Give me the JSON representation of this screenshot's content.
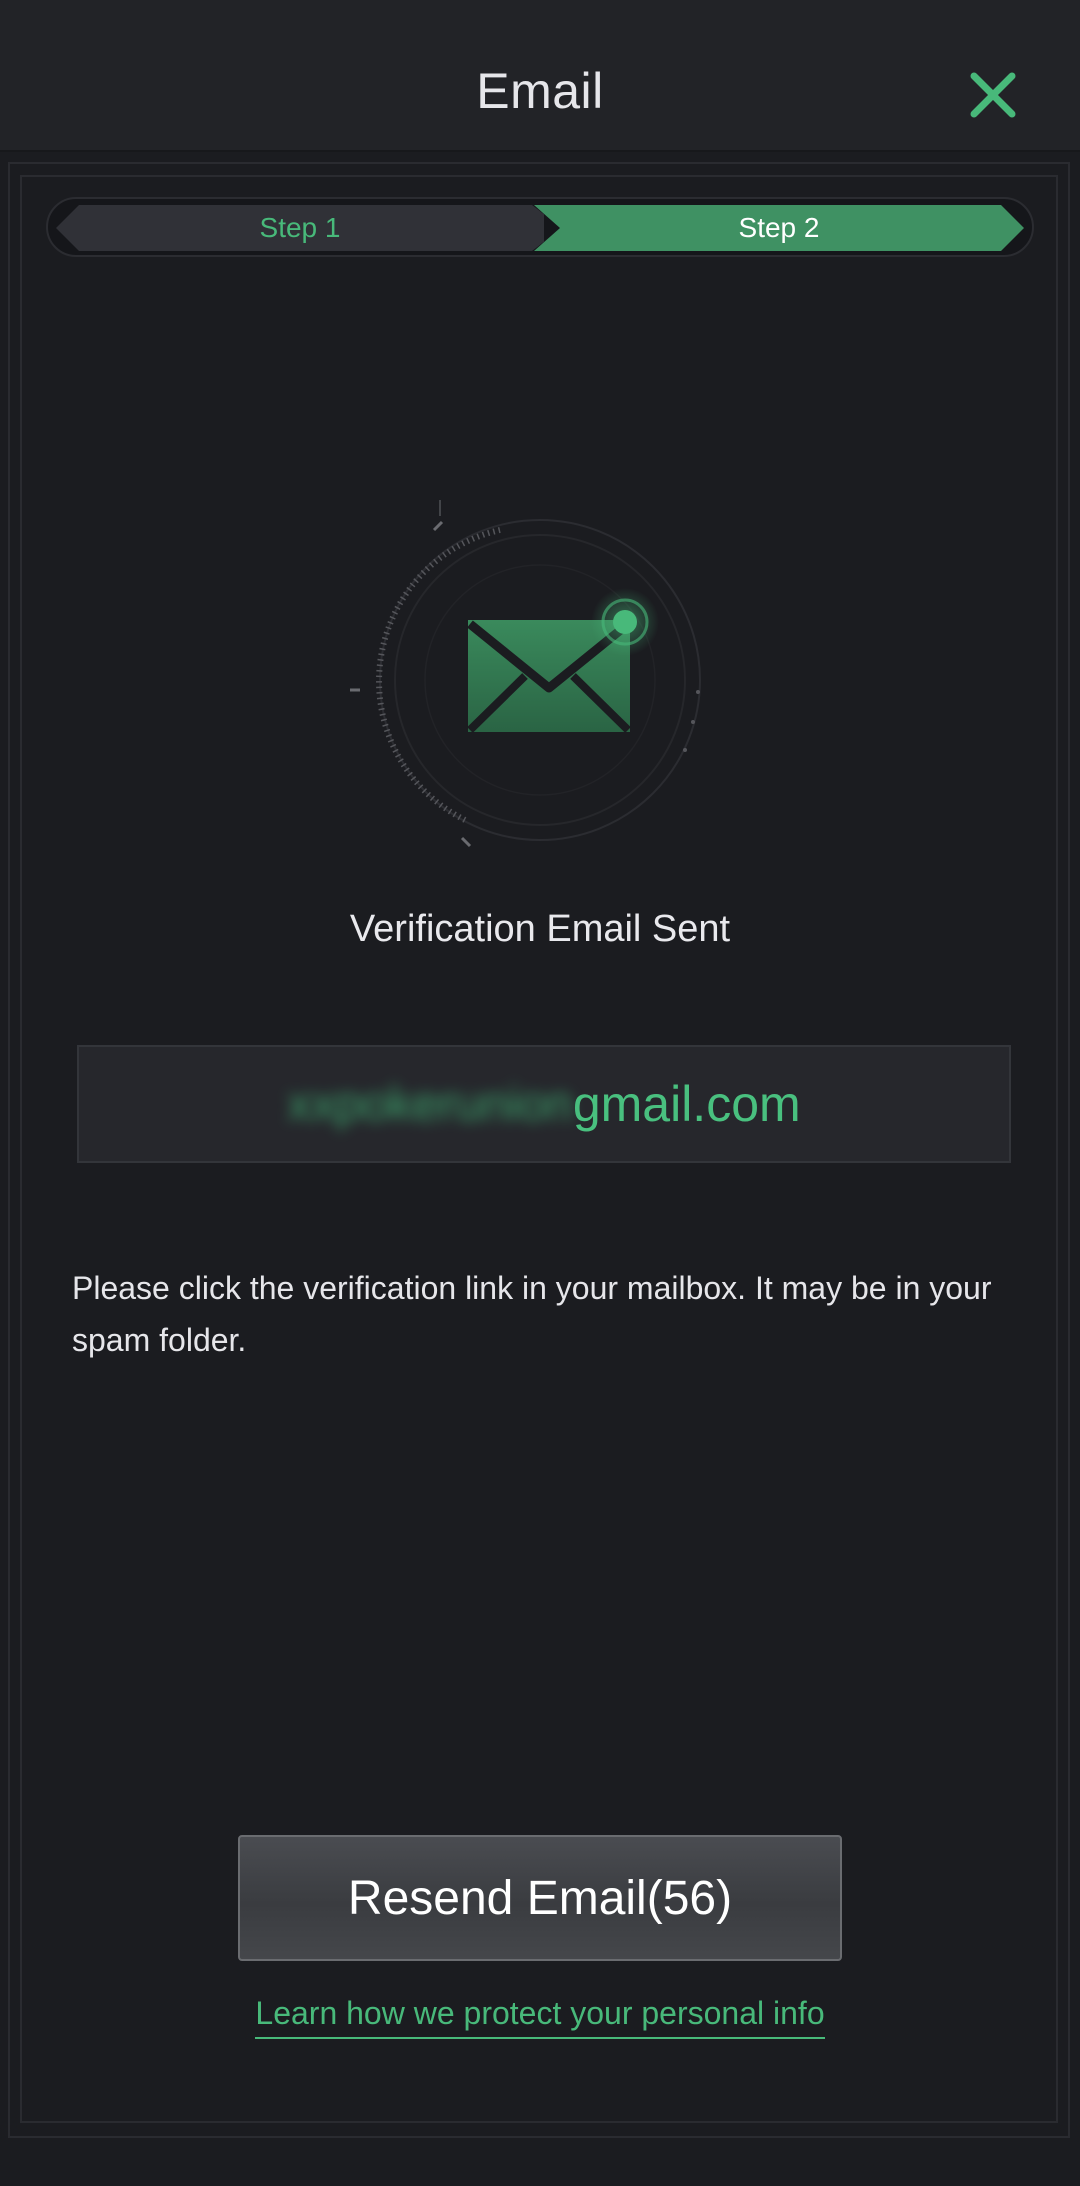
{
  "header": {
    "title": "Email",
    "close_icon": "close-x-icon"
  },
  "steps": {
    "step1_label": "Step 1",
    "step2_label": "Step 2",
    "active_step": 2
  },
  "illustration": {
    "icon": "envelope-icon"
  },
  "main": {
    "status_title": "Verification Email Sent",
    "email_masked_local": "xxpokerunion",
    "email_domain": "gmail.com",
    "instructions": "Please click the verification link in your mailbox. It may be in your spam folder."
  },
  "actions": {
    "resend_label": "Resend Email(56)",
    "learn_link": "Learn how we protect your personal info"
  },
  "colors": {
    "accent_green": "#48b97a",
    "background": "#1b1c20"
  }
}
